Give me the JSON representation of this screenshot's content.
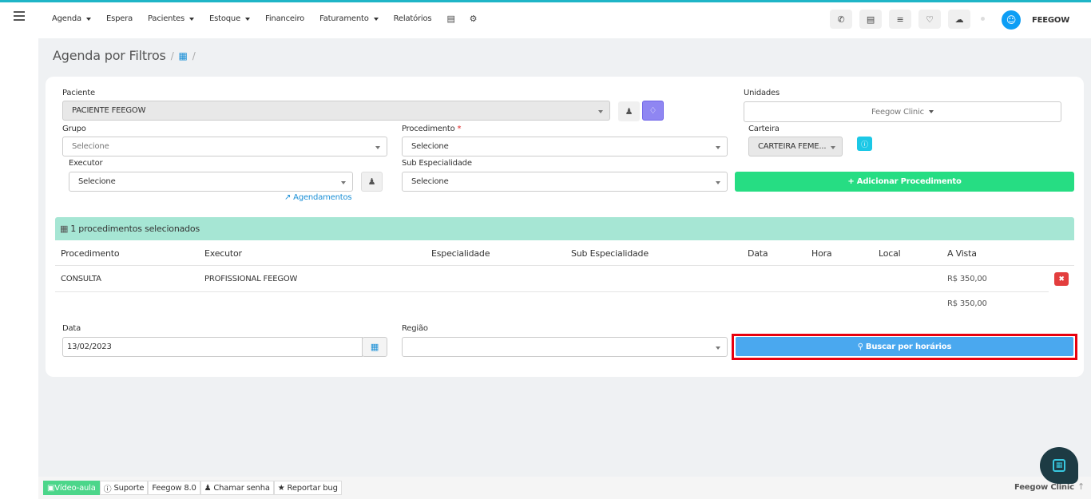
{
  "topbar": {
    "nav": [
      {
        "label": "Agenda",
        "dropdown": true
      },
      {
        "label": "Espera",
        "dropdown": false
      },
      {
        "label": "Pacientes",
        "dropdown": true
      },
      {
        "label": "Estoque",
        "dropdown": true
      },
      {
        "label": "Financeiro",
        "dropdown": false
      },
      {
        "label": "Faturamento",
        "dropdown": true
      },
      {
        "label": "Relatórios",
        "dropdown": false
      }
    ],
    "username": "FEEGOW"
  },
  "breadcrumb": {
    "title": "Agenda por Filtros",
    "sep": "/"
  },
  "form": {
    "paciente_label": "Paciente",
    "paciente_value": "PACIENTE FEEGOW",
    "unidades_label": "Unidades",
    "unidades_value": "Feegow Clinic",
    "grupo_label": "Grupo",
    "grupo_value": "Selecione",
    "procedimento_label": "Procedimento",
    "procedimento_required": "*",
    "procedimento_value": "Selecione",
    "carteira_label": "Carteira",
    "carteira_value": "CARTEIRA FEME...",
    "executor_label": "Executor",
    "executor_value": "Selecione",
    "sub_label": "Sub Especialidade",
    "sub_value": "Selecione",
    "agendamentos_link": "Agendamentos",
    "add_button": "+ Adicionar Procedimento",
    "data_label": "Data",
    "data_value": "13/02/2023",
    "regiao_label": "Região",
    "regiao_value": "",
    "search_button": "Buscar por horários"
  },
  "panel": {
    "header": "1 procedimentos selecionados",
    "columns": [
      "Procedimento",
      "Executor",
      "Especialidade",
      "Sub Especialidade",
      "Data",
      "Hora",
      "Local",
      "A Vista"
    ],
    "rows": [
      {
        "procedimento": "CONSULTA",
        "executor": "PROFISSIONAL FEEGOW",
        "especialidade": "",
        "sub": "",
        "data": "",
        "hora": "",
        "local": "",
        "avista": "R$ 350,00"
      }
    ],
    "total": "R$ 350,00"
  },
  "footer": {
    "video": "Vídeo-aula",
    "suporte": "Suporte",
    "version": "Feegow 8.0",
    "chamar": "Chamar senha",
    "bug": "Reportar bug",
    "brand": "Feegow Clinic"
  },
  "colors": {
    "accent": "#1fb5c7",
    "green": "#26dd83",
    "blue": "#4aa8ef",
    "highlight": "#e8000d"
  }
}
